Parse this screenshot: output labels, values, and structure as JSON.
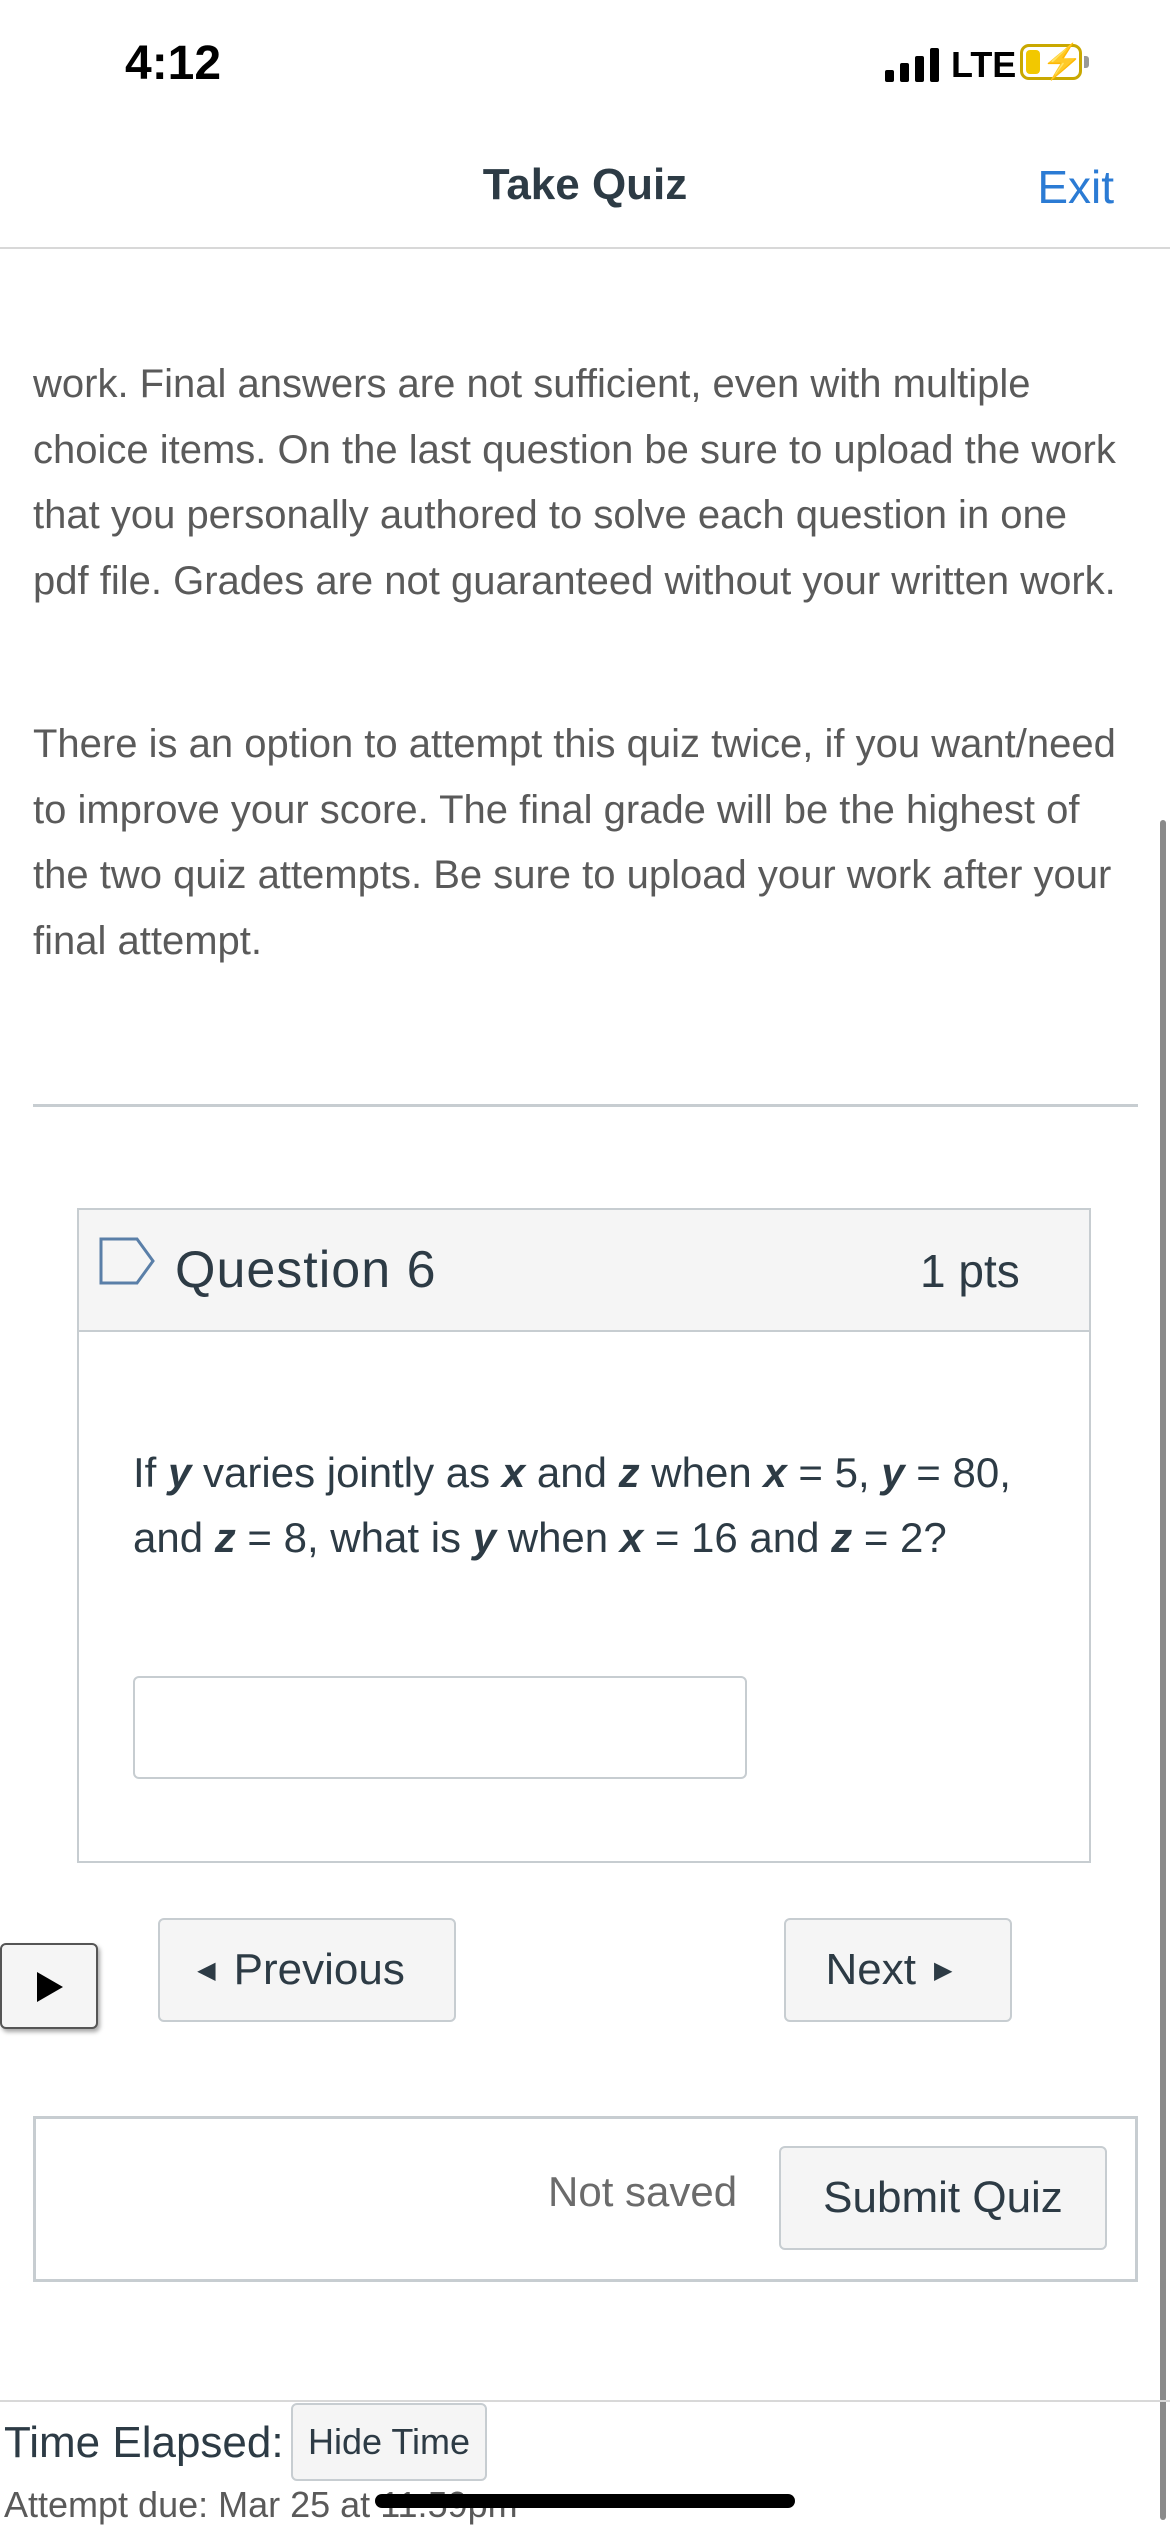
{
  "status_bar": {
    "time": "4:12",
    "network": "LTE",
    "battery_icon": "battery-charging-icon",
    "signal_icon": "signal-bars-icon"
  },
  "nav": {
    "title": "Take Quiz",
    "exit_label": "Exit",
    "accent_color": "#2b7bd4"
  },
  "instructions": {
    "paragraph_1": "work.  Final answers are not sufficient, even with multiple choice items.  On the last question be sure to upload the work that you personally authored to solve each question in one pdf file.  Grades are not guaranteed without your written work.",
    "paragraph_2": "There is an option to attempt this quiz twice, if you want/need to improve your score.  The final grade will be the highest of the two quiz attempts.  Be sure to upload your work after your final attempt."
  },
  "question": {
    "flag_icon": "bookmark-flag-icon",
    "title": "Question 6",
    "points": "1 pts",
    "text_parts": {
      "p1": "If ",
      "v1": "y",
      "p2": " varies jointly as ",
      "v2": "x",
      "p3": " and ",
      "v3": "z",
      "p4": " when ",
      "v4": "x",
      "p5": " = 5, ",
      "v5": "y",
      "p6": " = 80, and ",
      "v6": "z",
      "p7": " = 8, what is ",
      "v7": "y",
      "p8": " when ",
      "v8": "x",
      "p9": " = 16 and ",
      "v9": "z",
      "p10": " = 2?"
    },
    "answer_value": ""
  },
  "navigation": {
    "previous_label": "Previous",
    "next_label": "Next",
    "play_icon": "play-icon"
  },
  "submit": {
    "status": "Not saved",
    "button_label": "Submit Quiz"
  },
  "timer": {
    "label": "Time Elapsed:",
    "hide_button": "Hide Time",
    "due": "Attempt due: Mar 25 at 11:59pm"
  }
}
